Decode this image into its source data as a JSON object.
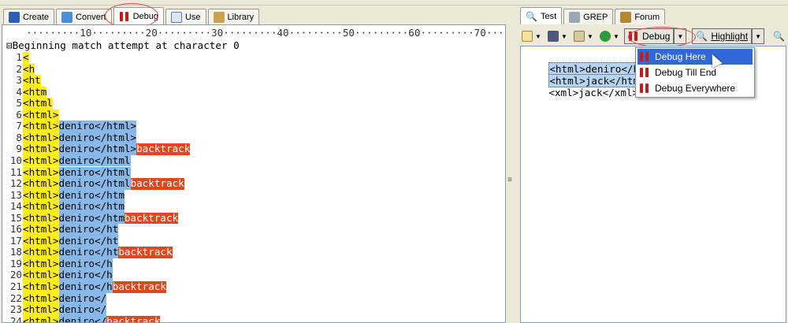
{
  "left_tabs": [
    {
      "label": "Create",
      "icon": "create-icon"
    },
    {
      "label": "Convert",
      "icon": "convert-icon"
    },
    {
      "label": "Debug",
      "icon": "debug-icon"
    },
    {
      "label": "Use",
      "icon": "use-icon"
    },
    {
      "label": "Library",
      "icon": "library-icon"
    }
  ],
  "ruler": "·········10·········20·········30·········40·········50·········60·········70·······",
  "debug_header": "⊟Beginning match attempt at character 0",
  "debug_lines": [
    {
      "n": "1",
      "y": "<",
      "b": "",
      "r": ""
    },
    {
      "n": "2",
      "y": "<h",
      "b": "",
      "r": ""
    },
    {
      "n": "3",
      "y": "<ht",
      "b": "",
      "r": ""
    },
    {
      "n": "4",
      "y": "<htm",
      "b": "",
      "r": ""
    },
    {
      "n": "5",
      "y": "<html",
      "b": "",
      "r": ""
    },
    {
      "n": "6",
      "y": "<html>",
      "b": "",
      "r": ""
    },
    {
      "n": "7",
      "y": "<html>",
      "b": "deniro</html>",
      "r": ""
    },
    {
      "n": "8",
      "y": "<html>",
      "b": "deniro</html>",
      "r": ""
    },
    {
      "n": "9",
      "y": "<html>",
      "b": "deniro</html>",
      "r": "backtrack"
    },
    {
      "n": "10",
      "y": "<html>",
      "b": "deniro</html",
      "r": ""
    },
    {
      "n": "11",
      "y": "<html>",
      "b": "deniro</html",
      "r": ""
    },
    {
      "n": "12",
      "y": "<html>",
      "b": "deniro</html",
      "r": "backtrack"
    },
    {
      "n": "13",
      "y": "<html>",
      "b": "deniro</htm",
      "r": ""
    },
    {
      "n": "14",
      "y": "<html>",
      "b": "deniro</htm",
      "r": ""
    },
    {
      "n": "15",
      "y": "<html>",
      "b": "deniro</htm",
      "r": "backtrack"
    },
    {
      "n": "16",
      "y": "<html>",
      "b": "deniro</ht",
      "r": ""
    },
    {
      "n": "17",
      "y": "<html>",
      "b": "deniro</ht",
      "r": ""
    },
    {
      "n": "18",
      "y": "<html>",
      "b": "deniro</ht",
      "r": "backtrack"
    },
    {
      "n": "19",
      "y": "<html>",
      "b": "deniro</h",
      "r": ""
    },
    {
      "n": "20",
      "y": "<html>",
      "b": "deniro</h",
      "r": ""
    },
    {
      "n": "21",
      "y": "<html>",
      "b": "deniro</h",
      "r": "backtrack"
    },
    {
      "n": "22",
      "y": "<html>",
      "b": "deniro</",
      "r": ""
    },
    {
      "n": "23",
      "y": "<html>",
      "b": "deniro</",
      "r": ""
    },
    {
      "n": "24",
      "y": "<html>",
      "b": "deniro</",
      "r": "backtrack"
    }
  ],
  "right_tabs": [
    {
      "label": "Test",
      "icon": "magnifier-icon"
    },
    {
      "label": "GREP",
      "icon": "grep-icon"
    },
    {
      "label": "Forum",
      "icon": "forum-icon"
    }
  ],
  "toolbar": {
    "debug_label": "Debug",
    "highlight_label": "Highlight"
  },
  "test_lines": [
    {
      "text": "<html>deniro</html>",
      "pilcrow": "¶"
    },
    {
      "text": "<html>jack</html>",
      "pilcrow": "¶"
    },
    {
      "text": "<xml>jack</xml>",
      "pilcrow": "¶"
    }
  ],
  "debug_menu": [
    {
      "label": "Debug Here",
      "highlighted": true
    },
    {
      "label": "Debug Till End",
      "highlighted": false
    },
    {
      "label": "Debug Everywhere",
      "highlighted": false
    }
  ],
  "colors": {
    "match_yellow": "#ffec1c",
    "match_blue": "#88b8e8",
    "backtrack_red": "#e0481c",
    "menu_highlight": "#3168d5"
  }
}
